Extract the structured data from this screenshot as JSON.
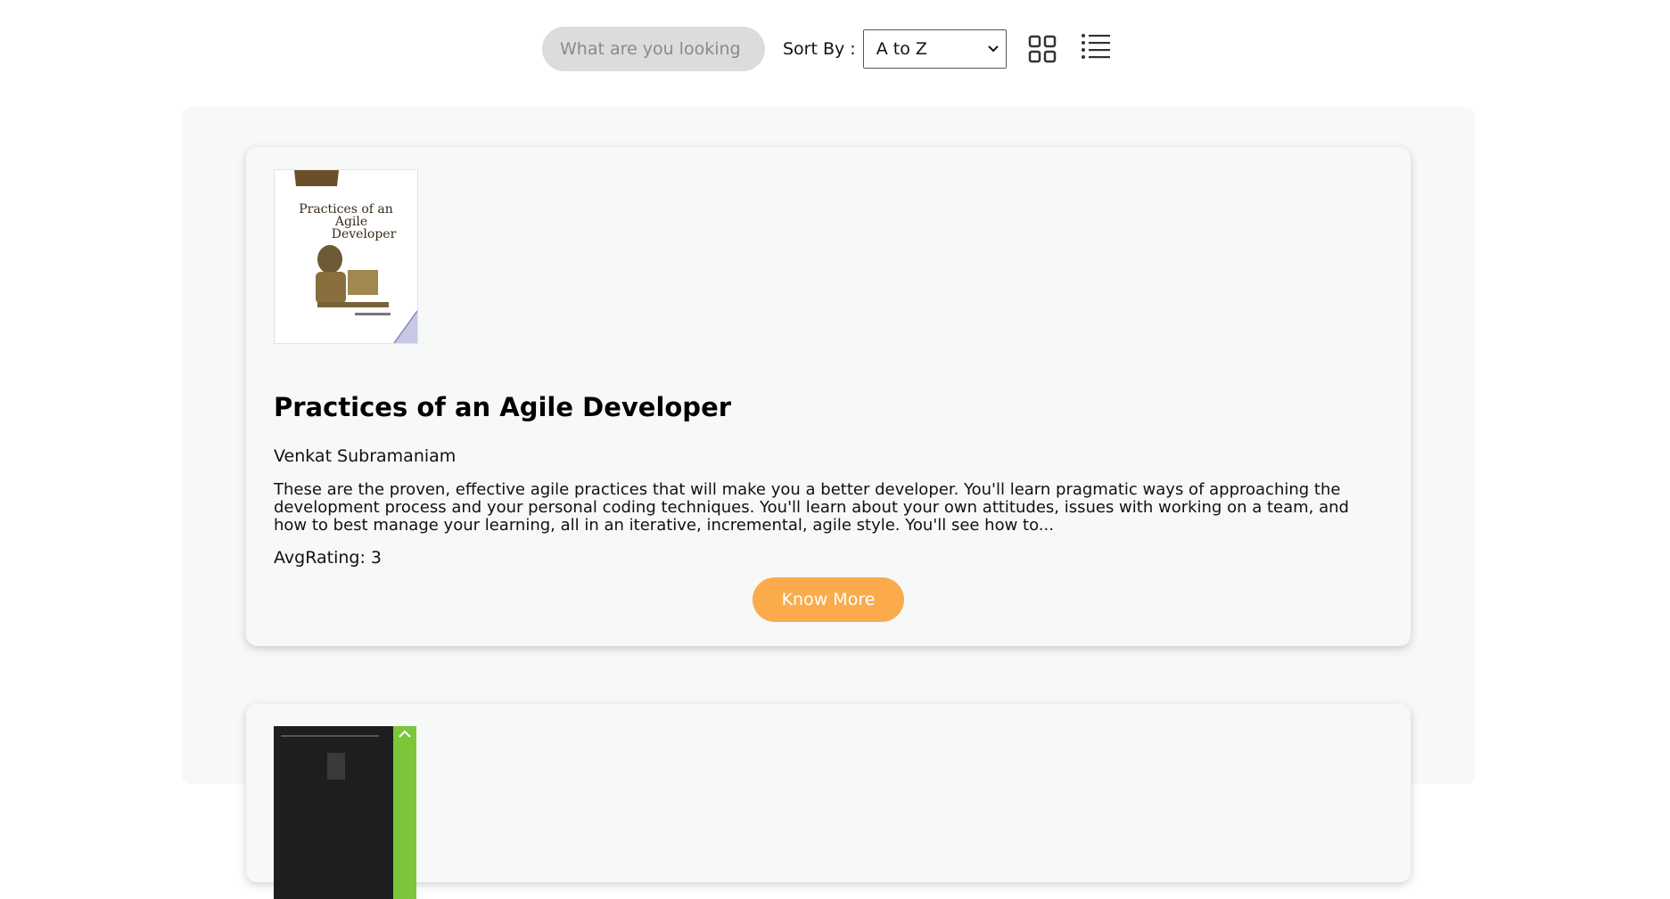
{
  "toolbar": {
    "search_placeholder": "What are you looking",
    "sort_label": "Sort By :",
    "sort_selected": "A to Z"
  },
  "books": [
    {
      "title": "Practices of an Agile Developer",
      "author": "Venkat Subramaniam",
      "description": "These are the proven, effective agile practices that will make you a better developer. You'll learn pragmatic ways of approaching the development process and your personal coding techniques. You'll learn about your own attitudes, issues with working on a team, and how to best manage your learning, all in an iterative, incremental, agile style. You'll see how to...",
      "rating": "AvgRating: 3",
      "button_label": "Know More",
      "cover": {
        "line1": "Practices of an",
        "line2": "Agile",
        "line3": "Developer"
      }
    }
  ],
  "colors": {
    "accent": "#fbab4c",
    "panel": "#f7f8f8",
    "search_bg": "#dcdcdc"
  }
}
